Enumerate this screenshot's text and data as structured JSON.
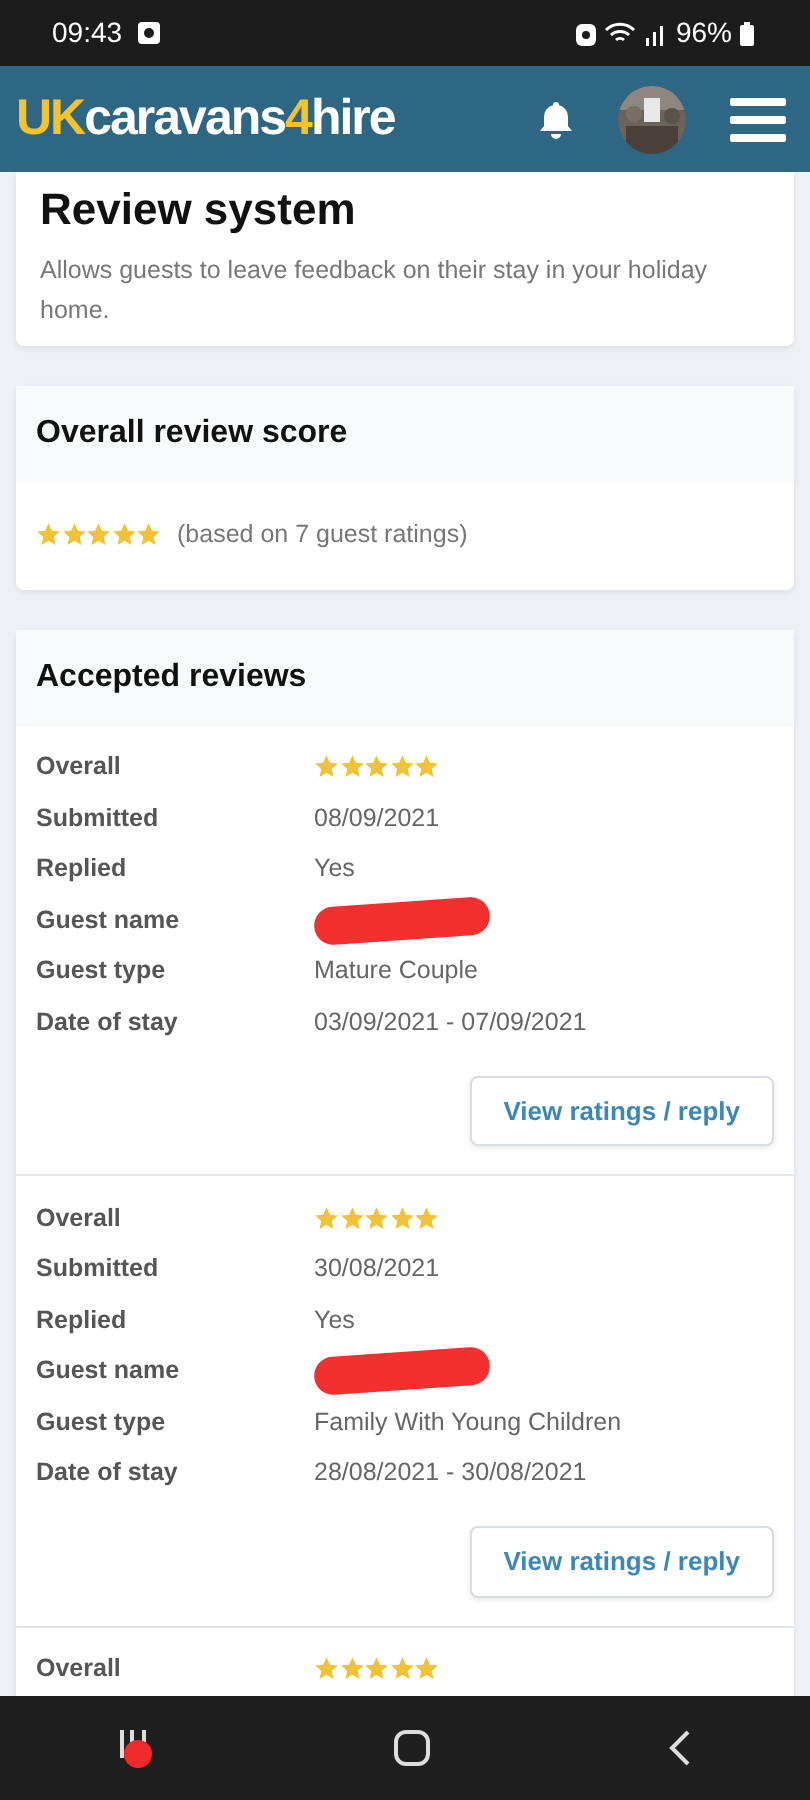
{
  "status_bar": {
    "time": "09:43",
    "battery": "96%"
  },
  "navbar": {
    "logo": [
      {
        "text": "UK",
        "highlight": true
      },
      {
        "text": "caravans",
        "highlight": false
      },
      {
        "text": "4",
        "highlight": true
      },
      {
        "text": "hire",
        "highlight": false
      }
    ]
  },
  "intro_card": {
    "title": "Review system",
    "description": "Allows guests to leave feedback on their stay in your holiday home."
  },
  "score_card": {
    "title": "Overall review score",
    "stars": 5,
    "note": "(based on 7 guest ratings)"
  },
  "reviews_card": {
    "title": "Accepted reviews",
    "reviews": [
      {
        "fields": [
          {
            "label": "Overall",
            "kind": "stars",
            "stars": 5
          },
          {
            "label": "Submitted",
            "kind": "text",
            "value": "08/09/2021"
          },
          {
            "label": "Replied",
            "kind": "text",
            "value": "Yes"
          },
          {
            "label": "Guest name",
            "kind": "redacted"
          },
          {
            "label": "Guest type",
            "kind": "text",
            "value": "Mature Couple"
          },
          {
            "label": "Date of stay",
            "kind": "text",
            "value": "03/09/2021 - 07/09/2021"
          }
        ],
        "button": "View ratings / reply"
      },
      {
        "fields": [
          {
            "label": "Overall",
            "kind": "stars",
            "stars": 5
          },
          {
            "label": "Submitted",
            "kind": "text",
            "value": "30/08/2021"
          },
          {
            "label": "Replied",
            "kind": "text",
            "value": "Yes"
          },
          {
            "label": "Guest name",
            "kind": "redacted"
          },
          {
            "label": "Guest type",
            "kind": "text",
            "value": "Family With Young Children"
          },
          {
            "label": "Date of stay",
            "kind": "text",
            "value": "28/08/2021 - 30/08/2021"
          }
        ],
        "button": "View ratings / reply"
      },
      {
        "fields": [
          {
            "label": "Overall",
            "kind": "stars",
            "stars": 5
          }
        ]
      }
    ]
  }
}
